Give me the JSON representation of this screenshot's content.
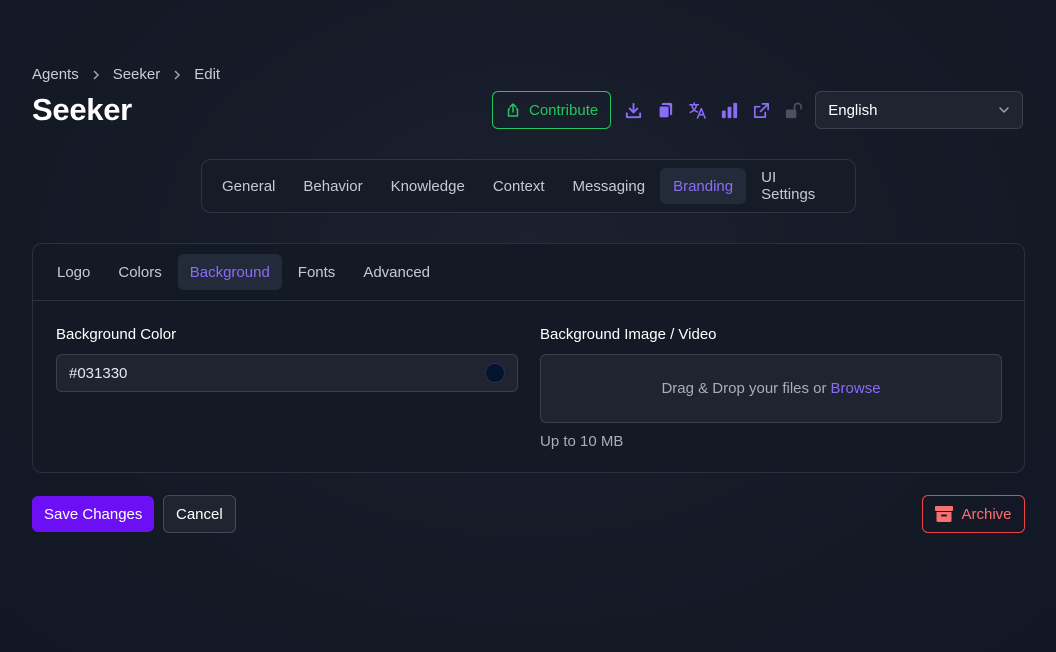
{
  "breadcrumb": {
    "items": [
      "Agents",
      "Seeker",
      "Edit"
    ]
  },
  "page_title": "Seeker",
  "header": {
    "contribute_label": "Contribute",
    "icons": [
      "download-icon",
      "copy-icon",
      "translate-icon",
      "stats-icon",
      "external-link-icon",
      "unlock-icon"
    ],
    "language": "English"
  },
  "main_tabs": [
    "General",
    "Behavior",
    "Knowledge",
    "Context",
    "Messaging",
    "Branding",
    "UI Settings"
  ],
  "main_tab_active": "Branding",
  "sub_tabs": [
    "Logo",
    "Colors",
    "Background",
    "Fonts",
    "Advanced"
  ],
  "sub_tab_active": "Background",
  "background_color": {
    "label": "Background Color",
    "value": "#031330"
  },
  "background_media": {
    "label": "Background Image / Video",
    "drop_text": "Drag & Drop your files or",
    "browse_label": "Browse",
    "hint": "Up to 10 MB"
  },
  "footer": {
    "save_label": "Save Changes",
    "cancel_label": "Cancel",
    "archive_label": "Archive"
  },
  "colors": {
    "accent": "#8b6cf6",
    "primary": "#6d0ff5",
    "success": "#22c55e",
    "danger": "#ef4444"
  }
}
